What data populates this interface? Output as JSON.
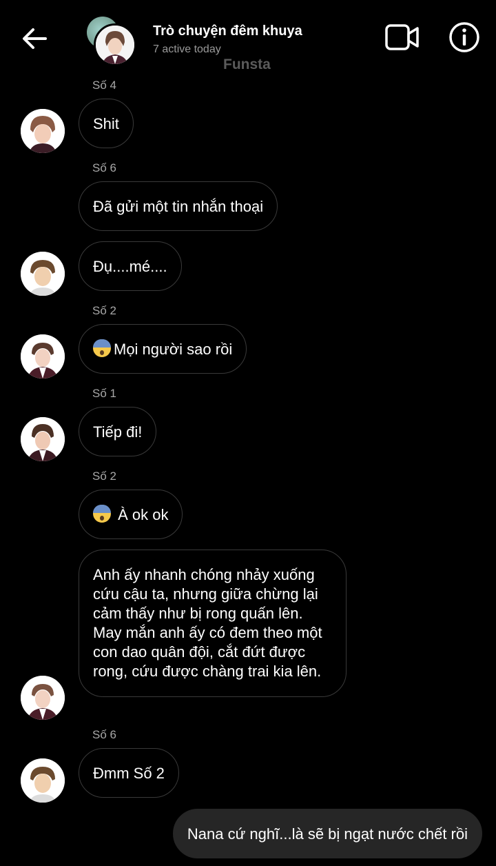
{
  "header": {
    "title": "Trò chuyện đêm khuya",
    "subtitle": "7 active today",
    "watermark": "Funsta"
  },
  "messages": [
    {
      "sender": "Số 4",
      "text": "Shit"
    },
    {
      "sender": "Số 6",
      "text": "Đã gửi một tin nhắn thoại"
    },
    {
      "text": "Đụ....mé...."
    },
    {
      "sender": "Số 2",
      "text": "Mọi người sao rồi",
      "emoji": "anxious-face-emoji"
    },
    {
      "sender": "Số 1",
      "text": "Tiếp đi!"
    },
    {
      "sender": "Số 2",
      "text": " À ok ok",
      "emoji": "anxious-face-emoji"
    },
    {
      "text": "Anh ấy nhanh chóng nhảy xuống cứu cậu ta, nhưng giữa chừng lại cảm thấy như bị rong quấn lên. May mắn anh ấy có đem theo một con dao quân đội, cắt đứt được rong, cứu được chàng trai kia lên."
    },
    {
      "sender": "Số 6",
      "text": "Đmm Số 2"
    },
    {
      "text": "Nana cứ nghĩ...là sẽ bị ngạt nước chết rồi",
      "own": true
    }
  ],
  "colors": {
    "background": "#000000",
    "own_bubble": "#262626",
    "bubble_border": "#3a3a3a",
    "muted_text": "#a8a8a8"
  }
}
